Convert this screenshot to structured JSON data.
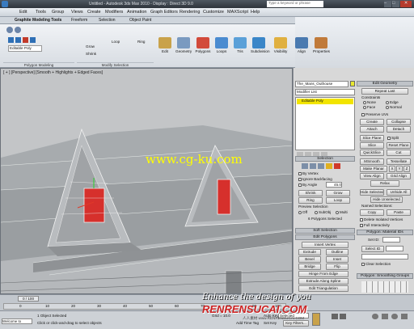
{
  "titlebar": {
    "text": "Untitled - Autodesk 3ds Max 2010 - Display : Direct 3D 9.0",
    "search": "Type a keyword or phrase"
  },
  "menu": [
    "Edit",
    "Tools",
    "Group",
    "Views",
    "Create",
    "Modifiers",
    "Animation",
    "Graph Editors",
    "Rendering",
    "Customize",
    "MAXScript",
    "Help"
  ],
  "ribbon": {
    "tabs": [
      "Graphite Modeling Tools",
      "Freeform",
      "Selection",
      "Object Paint"
    ],
    "obj_name": "Editable Poly",
    "poly_modeling": "Polygon Modeling",
    "mod_sel": "Modify Selection",
    "small": [
      "Grow",
      "Shrink",
      "Loop",
      "Ring"
    ],
    "buttons": [
      "Edit",
      "Geometry",
      "Polygons",
      "Loops",
      "Tris",
      "Subdivision",
      "Visibility",
      "Align",
      "Properties"
    ]
  },
  "viewport": {
    "label": "[ + ] [Perspective] [Smooth + Highlights + Edged Faces]"
  },
  "cmd": {
    "obj": "The_Mans_Outhouse",
    "modlist": "Modifier List",
    "stack_item": "Editable Poly",
    "selection": "Selection",
    "by_vertex": "By Vertex",
    "ignore_bf": "Ignore Backfacing",
    "by_angle": "By Angle",
    "by_angle_val": "45.0",
    "shrink": "Shrink",
    "grow": "Grow",
    "ring": "Ring",
    "loop": "Loop",
    "preview": "Preview Selection",
    "off": "Off",
    "subobj": "SubObj",
    "multi": "Multi",
    "polys_sel": "6 Polygons Selected",
    "soft": "Soft Selection",
    "edit_polys": "Edit Polygons",
    "insert_vertex": "Insert Vertex",
    "extrude": "Extrude",
    "outline": "Outline",
    "bevel": "Bevel",
    "inset": "Inset",
    "bridge": "Bridge",
    "flip": "Flip",
    "hinge": "Hinge From Edge",
    "extrude_spline": "Extrude Along Spline",
    "edit_tri": "Edit Triangulation",
    "retriangulate": "Retriangulate",
    "turn": "Turn",
    "edit_geom": "Edit Geometry",
    "repeat_last": "Repeat Last",
    "constraints": "Constraints",
    "c_none": "None",
    "c_edge": "Edge",
    "c_face": "Face",
    "c_normal": "Normal",
    "preserve_uvs": "Preserve UVs",
    "create": "Create",
    "collapse": "Collapse",
    "attach": "Attach",
    "detach": "Detach",
    "slice_plane": "Slice Plane",
    "split": "Split",
    "slice": "Slice",
    "reset_plane": "Reset Plane",
    "quickslice": "QuickSlice",
    "cut": "Cut",
    "meshsmooth": "MSmooth",
    "tessellate": "Tessellate",
    "make_planar": "Make Planar",
    "x": "X",
    "y": "Y",
    "z": "Z",
    "view_align": "View Align",
    "grid_align": "Grid Align",
    "relax": "Relax",
    "hide_sel": "Hide Selected",
    "unhide_all": "Unhide All",
    "hide_unsel": "Hide Unselected",
    "named_sel": "Named Selections:",
    "copy": "Copy",
    "paste": "Paste",
    "delete_iso": "Delete Isolated Vertices",
    "full_interactivity": "Full Interactivity",
    "poly_mat": "Polygon: Material IDs",
    "set_id": "Set ID:",
    "select_id": "Select ID",
    "clear_sel": "Clear Selection",
    "smoothing": "Polygon: Smoothing Groups"
  },
  "time": {
    "frame": "0 / 100",
    "ticks": [
      "0",
      "10",
      "20",
      "30",
      "40",
      "50",
      "60",
      "70",
      "80",
      "90",
      "100"
    ]
  },
  "status": {
    "object_selected": "1 Object Selected",
    "prompt": "Click or click-and-drag to select objects",
    "welcome": "Welcome to MAXScr",
    "grid": "Grid = 10.0",
    "add_time_tag": "Add Time Tag",
    "auto_key": "Auto Key",
    "selected": "Selected",
    "set_key": "Set Key",
    "key_filters": "Key Filters..."
  },
  "watermarks": {
    "cg": "www.cg-ku.com",
    "enhance": "Enhance the design of you",
    "rr": "RENRENSUCAI.COM",
    "rr_sub": "人人素材 www.RENRENSUCAI.COM"
  }
}
